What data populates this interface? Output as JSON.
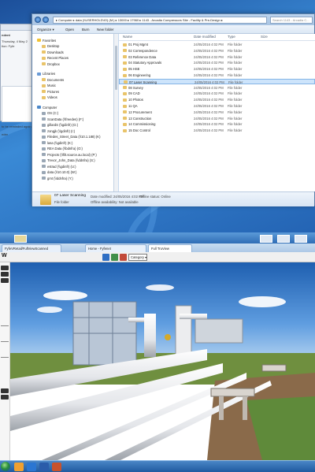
{
  "explorer": {
    "breadcrumb": "▸ Computer ▸ data (\\\\USERHOLD\\IO) (M:) ▸ 13000 ▸ 17960 ▸ 1143 - Arcadia Compressors Site - Facility & Pre-Design ▸",
    "search_placeholder": "Search 1143 - Arcadia C...",
    "toolbar": [
      "Organize ▾",
      "Open",
      "Burn",
      "New folder"
    ],
    "nav_favorites": [
      "Favorites",
      "Desktop",
      "Downloads",
      "Recent Places",
      "Dropbox"
    ],
    "nav_libraries": [
      "Libraries",
      "Documents",
      "Music",
      "Pictures",
      "Videos"
    ],
    "nav_computer": [
      "Computer",
      "OS (C:)",
      "ScanData (\\\\freedes) (F:)",
      "gillardS (\\\\gdinfr) (G:)",
      "zongjk (\\\\gdinfr) (I:)",
      "Filedes_Street_Data (\\\\10.1.188) (K)",
      "lasa (\\\\gdinfr) (K:)",
      "REA Data (\\\\bdnfra) (O:)",
      "Projects (\\\\filt.source.au.local) (P:)",
      "Trevor_John_Data (\\\\ddnfra) (S:)",
      "estrad (\\\\gdinfr) (U:)",
      "data (\\\\10.10.0) (W:)",
      "gmt (\\\\ddnfra) (Y:)"
    ],
    "columns": {
      "name": "Name",
      "date": "Date modified",
      "type": "Type",
      "size": "Size"
    },
    "folders": [
      {
        "name": "01 Proj Mgmt",
        "date": "24/05/2016 4:02 PM",
        "type": "File folder"
      },
      {
        "name": "02 Correspondence",
        "date": "24/05/2016 4:02 PM",
        "type": "File folder"
      },
      {
        "name": "03 Reference Data",
        "date": "24/05/2016 4:02 PM",
        "type": "File folder"
      },
      {
        "name": "04 Statutory Approvals",
        "date": "24/05/2016 4:02 PM",
        "type": "File folder"
      },
      {
        "name": "05 HSE",
        "date": "24/05/2016 4:02 PM",
        "type": "File folder"
      },
      {
        "name": "06 Engineering",
        "date": "24/05/2016 4:02 PM",
        "type": "File folder"
      },
      {
        "name": "07 Laser Scanning",
        "date": "24/05/2016 4:02 PM",
        "type": "File folder"
      },
      {
        "name": "08 Survey",
        "date": "24/05/2016 4:02 PM",
        "type": "File folder"
      },
      {
        "name": "09 CAD",
        "date": "24/05/2016 4:02 PM",
        "type": "File folder"
      },
      {
        "name": "10 Photos",
        "date": "24/05/2016 4:02 PM",
        "type": "File folder"
      },
      {
        "name": "11 QA",
        "date": "24/05/2016 4:02 PM",
        "type": "File folder"
      },
      {
        "name": "12 Procurement",
        "date": "24/05/2016 4:02 PM",
        "type": "File folder"
      },
      {
        "name": "13 Construction",
        "date": "24/05/2016 4:02 PM",
        "type": "File folder"
      },
      {
        "name": "14 Commissioning",
        "date": "24/05/2016 4:02 PM",
        "type": "File folder"
      },
      {
        "name": "15 Doc Control",
        "date": "24/05/2016 4:02 PM",
        "type": "File folder"
      }
    ],
    "selected_index": 6,
    "details": {
      "name": "07 Laser Scanning",
      "kind": "File folder",
      "date_label": "Date modified: 24/05/2016 4:02 PM",
      "offline_status": "Offline status: Online",
      "offline_avail": "Offline availability: Not available"
    }
  },
  "email": {
    "lines": [
      "ndent",
      "Thursday, 4 May 2",
      "tion: Fyfe",
      "to be reminded again",
      "nder"
    ]
  },
  "browser": {
    "tabs": [
      "FyfeVRetail/FullViewScanned",
      "Home - Fyfenet",
      "Full TruView"
    ],
    "category": "Category ▾",
    "logo": "W"
  },
  "colors": {
    "desktop": "#2d6fb8",
    "selection": "#cde4fb",
    "taskbar": "#1f5aa0"
  }
}
